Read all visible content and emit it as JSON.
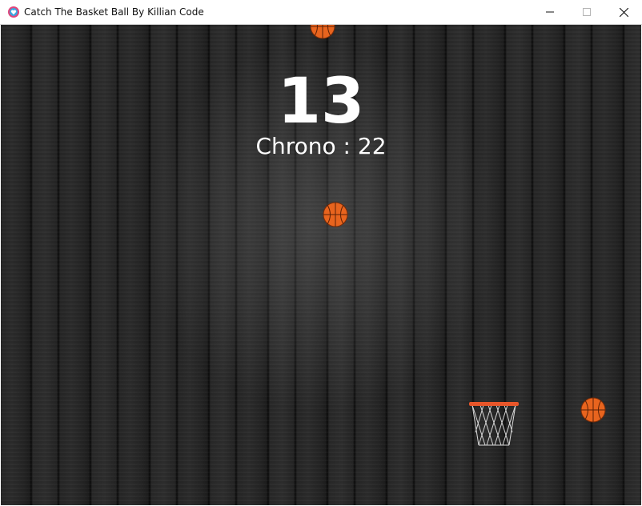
{
  "window": {
    "title": "Catch The Basket Ball By Killian Code",
    "app_icon": "heart-app-icon",
    "buttons": [
      "minimize-icon",
      "maximize-icon",
      "close-icon"
    ]
  },
  "hud": {
    "score": "13",
    "chrono_label": "Chrono : 22"
  },
  "colors": {
    "ball": "#e8641e",
    "rim": "#e8562a",
    "net": "#d8d8d8",
    "text": "#ffffff",
    "background": "#262626"
  }
}
